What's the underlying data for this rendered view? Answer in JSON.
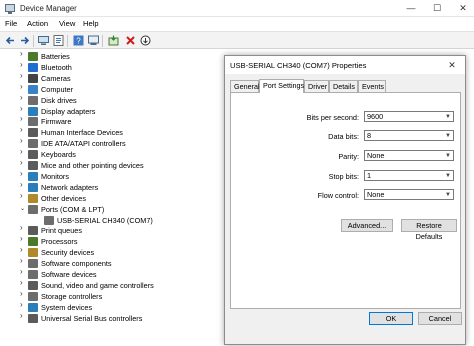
{
  "window": {
    "title": "Device Manager",
    "controls": {
      "minimize": "—",
      "maximize": "☐",
      "close": "✕"
    }
  },
  "menu": [
    "File",
    "Action",
    "View",
    "Help"
  ],
  "toolbar_icons": [
    "back-icon",
    "forward-icon",
    "computer-icon",
    "properties-icon",
    "help-icon",
    "scan-icon",
    "update-driver-icon",
    "uninstall-icon",
    "disable-icon"
  ],
  "tree": {
    "items": [
      {
        "label": "Batteries",
        "expanded": false,
        "color": "#4a7a2a"
      },
      {
        "label": "Bluetooth",
        "expanded": false,
        "color": "#1f6fd1"
      },
      {
        "label": "Cameras",
        "expanded": false,
        "color": "#444444"
      },
      {
        "label": "Computer",
        "expanded": false,
        "color": "#3a82c6"
      },
      {
        "label": "Disk drives",
        "expanded": false,
        "color": "#6d6d6d"
      },
      {
        "label": "Display adapters",
        "expanded": false,
        "color": "#2a7fba"
      },
      {
        "label": "Firmware",
        "expanded": false,
        "color": "#6d6d6d"
      },
      {
        "label": "Human Interface Devices",
        "expanded": false,
        "color": "#5b5b5b"
      },
      {
        "label": "IDE ATA/ATAPI controllers",
        "expanded": false,
        "color": "#6d6d6d"
      },
      {
        "label": "Keyboards",
        "expanded": false,
        "color": "#5b5b5b"
      },
      {
        "label": "Mice and other pointing devices",
        "expanded": false,
        "color": "#5b5b5b"
      },
      {
        "label": "Monitors",
        "expanded": false,
        "color": "#2a7fba"
      },
      {
        "label": "Network adapters",
        "expanded": false,
        "color": "#2a7fba"
      },
      {
        "label": "Other devices",
        "expanded": false,
        "color": "#b08a2a"
      },
      {
        "label": "Ports (COM & LPT)",
        "expanded": true,
        "color": "#6d6d6d"
      },
      {
        "label": "USB-SERIAL CH340 (COM7)",
        "child": true,
        "color": "#6d6d6d"
      },
      {
        "label": "Print queues",
        "expanded": false,
        "color": "#5b5b5b"
      },
      {
        "label": "Processors",
        "expanded": false,
        "color": "#4a7a2a"
      },
      {
        "label": "Security devices",
        "expanded": false,
        "color": "#b08a2a"
      },
      {
        "label": "Software components",
        "expanded": false,
        "color": "#6d6d6d"
      },
      {
        "label": "Software devices",
        "expanded": false,
        "color": "#6d6d6d"
      },
      {
        "label": "Sound, video and game controllers",
        "expanded": false,
        "color": "#5b5b5b"
      },
      {
        "label": "Storage controllers",
        "expanded": false,
        "color": "#6d6d6d"
      },
      {
        "label": "System devices",
        "expanded": false,
        "color": "#2a7fba"
      },
      {
        "label": "Universal Serial Bus controllers",
        "expanded": false,
        "color": "#5b5b5b"
      }
    ]
  },
  "dialog": {
    "title": "USB-SERIAL CH340 (COM7) Properties",
    "close": "✕",
    "tabs": [
      {
        "label": "General",
        "active": false
      },
      {
        "label": "Port Settings",
        "active": true
      },
      {
        "label": "Driver",
        "active": false
      },
      {
        "label": "Details",
        "active": false
      },
      {
        "label": "Events",
        "active": false
      }
    ],
    "fields": [
      {
        "label": "Bits per second:",
        "value": "9600"
      },
      {
        "label": "Data bits:",
        "value": "8"
      },
      {
        "label": "Parity:",
        "value": "None"
      },
      {
        "label": "Stop bits:",
        "value": "1"
      },
      {
        "label": "Flow control:",
        "value": "None"
      }
    ],
    "advanced_button": "Advanced...",
    "restore_button": "Restore Defaults",
    "ok_button": "OK",
    "cancel_button": "Cancel"
  },
  "colors": {
    "accent": "#0078d7",
    "dialog_bg": "#f0f0f0",
    "toolbar_bg": "#f3f3f3"
  }
}
